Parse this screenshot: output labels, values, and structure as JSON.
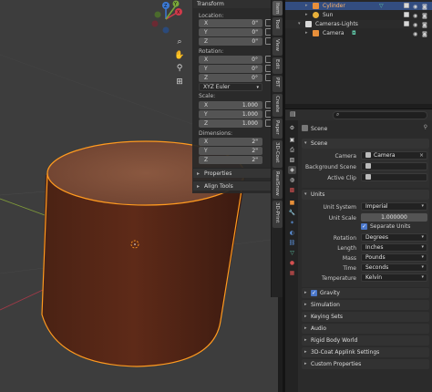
{
  "viewport": {
    "gizmo_axes": [
      "X",
      "Y",
      "Z"
    ]
  },
  "npanel": {
    "header": "Transform",
    "location_label": "Location:",
    "location": [
      {
        "axis": "X",
        "value": "0\""
      },
      {
        "axis": "Y",
        "value": "0\""
      },
      {
        "axis": "Z",
        "value": "0\""
      }
    ],
    "rotation_label": "Rotation:",
    "rotation": [
      {
        "axis": "X",
        "value": "0°"
      },
      {
        "axis": "Y",
        "value": "0°"
      },
      {
        "axis": "Z",
        "value": "0°"
      }
    ],
    "rotation_mode": "XYZ Euler",
    "scale_label": "Scale:",
    "scale": [
      {
        "axis": "X",
        "value": "1.000"
      },
      {
        "axis": "Y",
        "value": "1.000"
      },
      {
        "axis": "Z",
        "value": "1.000"
      }
    ],
    "dimensions_label": "Dimensions:",
    "dimensions": [
      {
        "axis": "X",
        "value": "2\""
      },
      {
        "axis": "Y",
        "value": "2\""
      },
      {
        "axis": "Z",
        "value": "2\""
      }
    ],
    "properties_section": "Properties",
    "align_tools_section": "Align Tools"
  },
  "sidebar_tabs": [
    "Item",
    "Tool",
    "View",
    "Edit",
    "PBT",
    "Create",
    "Paper",
    "3D-Coat",
    "RealSnow",
    "3D-Print"
  ],
  "outliner": {
    "rows": [
      {
        "label": "Cylinder",
        "selected": true
      },
      {
        "label": "Sun",
        "selected": false
      },
      {
        "label": "Cameras-Lights",
        "selected": false
      },
      {
        "label": "Camera",
        "selected": false
      }
    ]
  },
  "properties": {
    "breadcrumb": "Scene",
    "scene_section": "Scene",
    "camera_label": "Camera",
    "camera_value": "Camera",
    "background_scene_label": "Background Scene",
    "active_clip_label": "Active Clip",
    "units_section": "Units",
    "unit_system_label": "Unit System",
    "unit_system_value": "Imperial",
    "unit_scale_label": "Unit Scale",
    "unit_scale_value": "1.000000",
    "separate_units_label": "Separate Units",
    "rotation_label": "Rotation",
    "rotation_value": "Degrees",
    "length_label": "Length",
    "length_value": "Inches",
    "mass_label": "Mass",
    "mass_value": "Pounds",
    "time_label": "Time",
    "time_value": "Seconds",
    "temperature_label": "Temperature",
    "temperature_value": "Kelvin",
    "gravity_section": "Gravity",
    "simulation_section": "Simulation",
    "keying_sets_section": "Keying Sets",
    "audio_section": "Audio",
    "rigid_body_section": "Rigid Body World",
    "applink_section": "3D-Coat Applink Settings",
    "custom_props_section": "Custom Properties"
  },
  "colors": {
    "accent": "#4b77c9",
    "selection_outline": "#ff9a1f",
    "cylinder": "#5a2a1a",
    "viewport_bg": "#3d3d3d"
  }
}
